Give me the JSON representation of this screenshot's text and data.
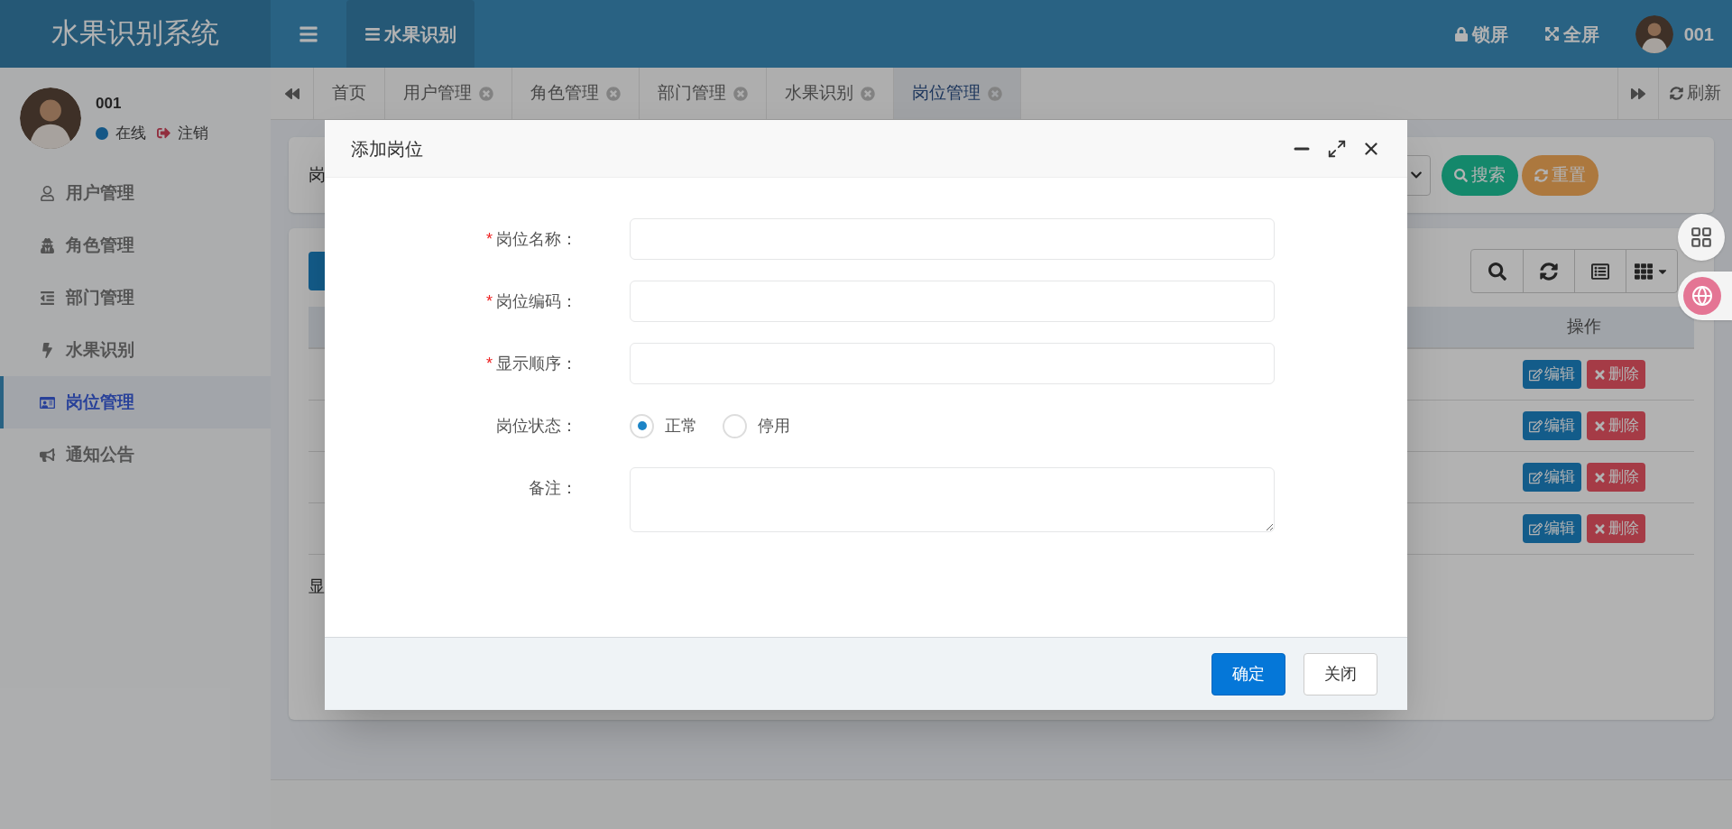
{
  "header": {
    "logo": "水果识别系统",
    "menu_tab": "水果识别",
    "actions": [
      {
        "label": "锁屏"
      },
      {
        "label": "全屏"
      }
    ],
    "user": "001"
  },
  "sidebar": {
    "user": {
      "name": "001",
      "status": "在线",
      "logout": "注销"
    },
    "items": [
      {
        "label": "用户管理",
        "selected": false
      },
      {
        "label": "角色管理",
        "selected": false
      },
      {
        "label": "部门管理",
        "selected": false
      },
      {
        "label": "水果识别",
        "selected": false
      },
      {
        "label": "岗位管理",
        "selected": true
      },
      {
        "label": "通知公告",
        "selected": false
      }
    ]
  },
  "tabs": [
    {
      "label": "首页",
      "closable": false,
      "selected": false
    },
    {
      "label": "用户管理",
      "closable": true,
      "selected": false
    },
    {
      "label": "角色管理",
      "closable": true,
      "selected": false
    },
    {
      "label": "部门管理",
      "closable": true,
      "selected": false
    },
    {
      "label": "水果识别",
      "closable": true,
      "selected": false
    },
    {
      "label": "岗位管理",
      "closable": true,
      "selected": true
    }
  ],
  "refresh": "刷新",
  "search_panel": {
    "label_fragment": "岗",
    "buttons": [
      {
        "kind": "search",
        "label": "搜索"
      },
      {
        "kind": "reset",
        "label": "重置"
      }
    ]
  },
  "table": {
    "columns": [
      {
        "label": "操作"
      }
    ],
    "rows": [
      {
        "actions": [
          {
            "kind": "edit",
            "label": "编辑"
          },
          {
            "kind": "delete",
            "label": "删除"
          }
        ]
      },
      {
        "actions": [
          {
            "kind": "edit",
            "label": "编辑"
          },
          {
            "kind": "delete",
            "label": "删除"
          }
        ]
      },
      {
        "actions": [
          {
            "kind": "edit",
            "label": "编辑"
          },
          {
            "kind": "delete",
            "label": "删除"
          }
        ]
      },
      {
        "actions": [
          {
            "kind": "edit",
            "label": "编辑"
          },
          {
            "kind": "delete",
            "label": "删除"
          }
        ]
      }
    ],
    "footer_fragment": "显"
  },
  "dialog": {
    "title": "添加岗位",
    "required_mark": "*",
    "fields": [
      {
        "kind": "text",
        "label": "岗位名称：",
        "required": true
      },
      {
        "kind": "text",
        "label": "岗位编码：",
        "required": true
      },
      {
        "kind": "text",
        "label": "显示顺序：",
        "required": true
      },
      {
        "kind": "radio",
        "label": "岗位状态：",
        "required": false,
        "options": [
          {
            "label": "正常",
            "selected": true
          },
          {
            "label": "停用",
            "selected": false
          }
        ]
      },
      {
        "kind": "textarea",
        "label": "备注：",
        "required": false
      }
    ],
    "buttons": [
      {
        "kind": "primary",
        "label": "确定"
      },
      {
        "kind": "default",
        "label": "关闭"
      }
    ]
  }
}
